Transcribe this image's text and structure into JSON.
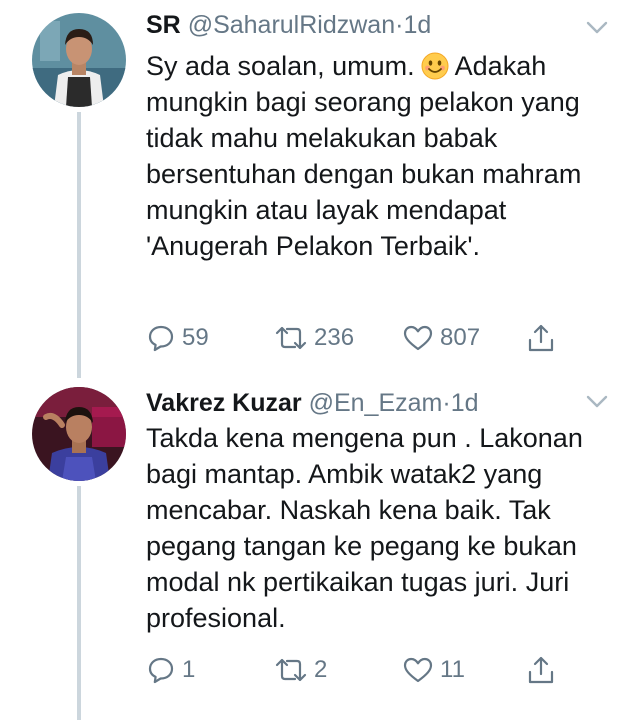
{
  "tweets": [
    {
      "display_name": "SR",
      "handle": "@SaharulRidzwan",
      "separator": "·",
      "time": "1d",
      "text_before_emoji": "Sy ada soalan, umum.",
      "emoji": "smiling-face-emoji",
      "text_after_emoji": "Adakah mungkin bagi seorang pelakon yang tidak mahu melakukan babak bersentuhan dengan bukan mahram mungkin atau layak mendapat 'Anugerah Pelakon Terbaik'.",
      "replies": "59",
      "retweets": "236",
      "likes": "807"
    },
    {
      "display_name": "Vakrez Kuzar",
      "handle": "@En_Ezam",
      "separator": "·",
      "time": "1d",
      "text": "Takda kena mengena pun . Lakonan bagi mantap. Ambik watak2 yang mencabar. Naskah kena baik. Tak pegang tangan ke pegang ke bukan modal nk pertikaikan tugas juri. Juri profesional.",
      "replies": "1",
      "retweets": "2",
      "likes": "11"
    }
  ],
  "colors": {
    "text": "#14171a",
    "secondary": "#657786",
    "thread_line": "#ccd6dd"
  }
}
